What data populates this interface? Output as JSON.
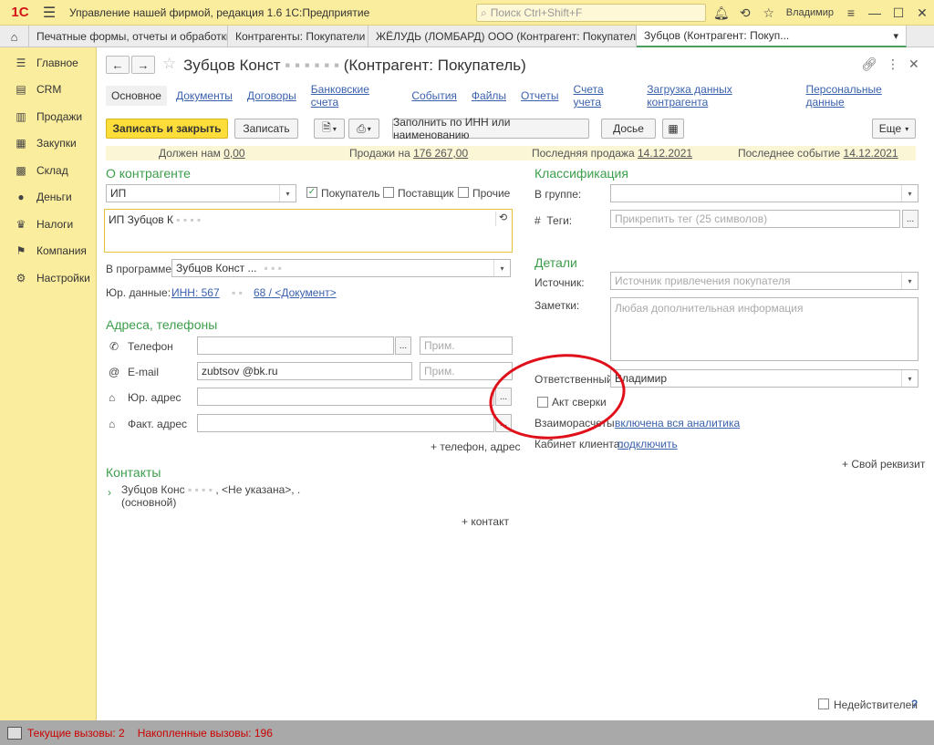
{
  "titlebar": {
    "logo": "1С",
    "title": "Управление нашей фирмой, редакция 1.6 1С:Предприятие",
    "search_placeholder": "Поиск Ctrl+Shift+F",
    "user": "Владимир"
  },
  "tabs": [
    {
      "label": "Печатные формы, отчеты и обработки"
    },
    {
      "label": "Контрагенты: Покупатели"
    },
    {
      "label": "ЖЁЛУДЬ (ЛОМБАРД) ООО (Контрагент: Покупатель)"
    },
    {
      "label": "Зубцов (Контрагент: Покуп..."
    }
  ],
  "sidebar": {
    "items": [
      {
        "label": "Главное",
        "icon": "menu-icon"
      },
      {
        "label": "CRM",
        "icon": "crm-icon"
      },
      {
        "label": "Продажи",
        "icon": "sales-icon"
      },
      {
        "label": "Закупки",
        "icon": "purchases-icon"
      },
      {
        "label": "Склад",
        "icon": "warehouse-icon"
      },
      {
        "label": "Деньги",
        "icon": "money-icon"
      },
      {
        "label": "Налоги",
        "icon": "taxes-icon"
      },
      {
        "label": "Компания",
        "icon": "company-icon"
      },
      {
        "label": "Настройки",
        "icon": "settings-icon"
      }
    ]
  },
  "form": {
    "title_name": "Зубцов Конст",
    "title_suffix": "(Контрагент: Покупатель)",
    "links": [
      "Основное",
      "Документы",
      "Договоры",
      "Банковские счета",
      "События",
      "Файлы",
      "Отчеты",
      "Счета учета",
      "Загрузка данных контрагента",
      "Персональные данные"
    ],
    "buttons": {
      "save_close": "Записать и закрыть",
      "save": "Записать",
      "fill_inn": "Заполнить по ИНН или наименованию",
      "dossier": "Досье",
      "more": "Еще"
    },
    "info": {
      "owes_label": "Должен нам",
      "owes_value": "0,00",
      "sales_label": "Продажи на",
      "sales_value": "176 267,00",
      "last_sale_label": "Последняя продажа",
      "last_sale_value": "14.12.2021",
      "last_event_label": "Последнее событие",
      "last_event_value": "14.12.2021"
    },
    "about": {
      "section": "О контрагенте",
      "type_value": "ИП",
      "buyer": "Покупатель",
      "supplier": "Поставщик",
      "other": "Прочие",
      "full_name": "ИП Зубцов К",
      "program_label": "В программе:",
      "program_value": "Зубцов Конст ...",
      "legal_label": "Юр. данные:",
      "legal_value_a": "ИНН: 567",
      "legal_value_b": "68 / <Документ>"
    },
    "contacts": {
      "section": "Адреса, телефоны",
      "phone_label": "Телефон",
      "email_label": "E-mail",
      "email_value": "zubtsov     @bk.ru",
      "legal_addr_label": "Юр. адрес",
      "fact_addr_label": "Факт. адрес",
      "note_placeholder": "Прим.",
      "add": "+ телефон, адрес"
    },
    "people": {
      "section": "Контакты",
      "person": "Зубцов Конс",
      "person_rest": ", <Не указана>, .",
      "main": "(основной)",
      "add": "+ контакт"
    },
    "classification": {
      "section": "Классификация",
      "group_label": "В группе:",
      "tags_label": "Теги:",
      "tags_placeholder": "Прикрепить тег (25 символов)"
    },
    "details": {
      "section": "Детали",
      "source_label": "Источник:",
      "source_placeholder": "Источник привлечения покупателя",
      "notes_label": "Заметки:",
      "notes_placeholder": "Любая дополнительная информация",
      "responsible_label": "Ответственный:",
      "responsible_value": "Владимир",
      "reconciliation": "Акт сверки",
      "settlements_label": "Взаиморасчеты:",
      "settlements_value": "включена вся аналитика",
      "cabinet_label": "Кабинет клиента:",
      "cabinet_value": "подключить",
      "own_attr": "+ Свой реквизит",
      "invalid": "Недействителен"
    }
  },
  "status": {
    "current": "Текущие вызовы: 2",
    "accumulated": "Накопленные вызовы: 196"
  },
  "colors": {
    "accent": "#fbed9e",
    "green": "#3c9e4b",
    "link": "#3a61ad",
    "annotation": "#e0101a"
  }
}
